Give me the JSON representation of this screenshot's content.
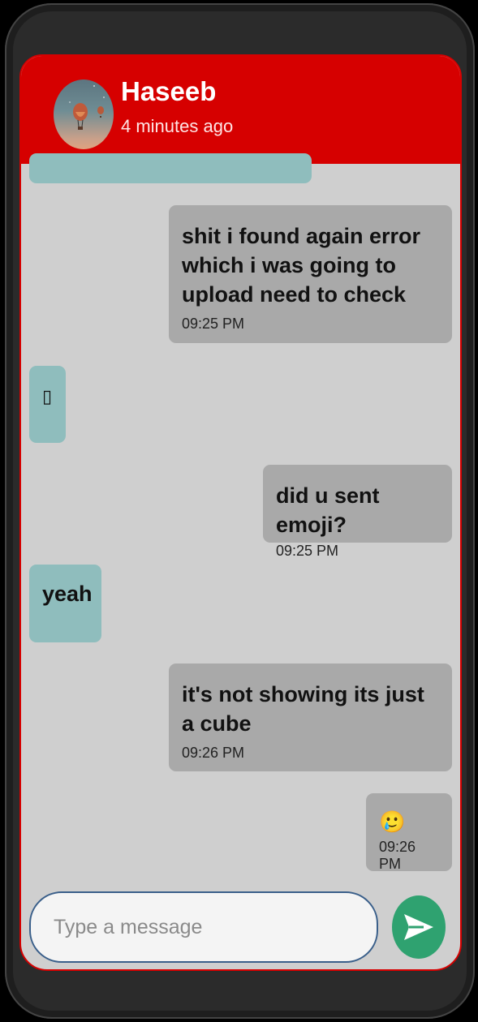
{
  "header": {
    "contact_name": "Haseeb",
    "status": "4 minutes ago"
  },
  "messages": [
    {
      "side": "sent",
      "text": "shit i found again error which i was going to upload need to check",
      "time": "09:25 PM"
    },
    {
      "side": "received",
      "text": "▯",
      "time": ""
    },
    {
      "side": "sent",
      "text": "did u sent emoji?",
      "time": "09:25 PM"
    },
    {
      "side": "received",
      "text": "yeah",
      "time": ""
    },
    {
      "side": "sent",
      "text": "it's not showing its just a cube",
      "time": "09:26 PM"
    },
    {
      "side": "sent",
      "text": "🥲",
      "time": "09:26 PM"
    }
  ],
  "composer": {
    "placeholder": "Type a message"
  },
  "icons": {
    "send": "send-icon",
    "avatar": "hot-air-balloon-avatar"
  },
  "colors": {
    "header": "#d60000",
    "sent_bubble": "#a9a9a9",
    "received_bubble": "#8fbdbd",
    "send_button": "#2fa270"
  }
}
